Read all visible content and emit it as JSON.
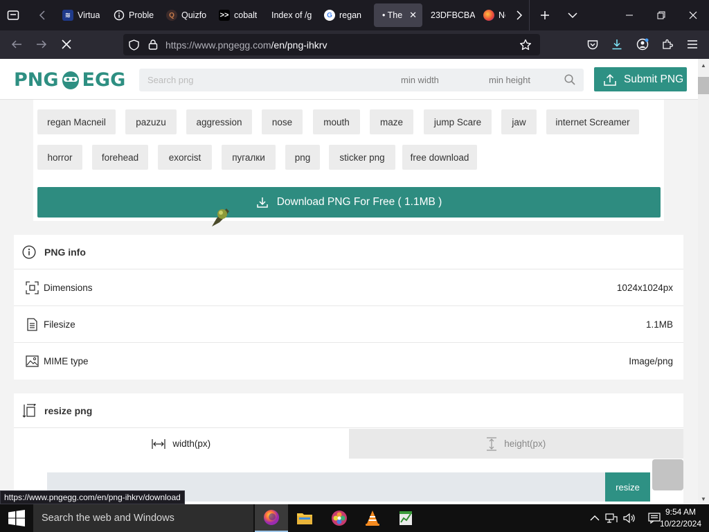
{
  "tabs": [
    {
      "title": "Virtua",
      "icon": "virtualbox-icon"
    },
    {
      "title": "Proble",
      "icon": "info-icon"
    },
    {
      "title": "Quizfo",
      "icon": "quizfor-icon"
    },
    {
      "title": "cobalt",
      "icon": "cobalt-icon"
    },
    {
      "title": "Index of /g",
      "icon": "blank-icon"
    },
    {
      "title": "regan",
      "icon": "google-icon"
    },
    {
      "title": "• The",
      "icon": "loading-icon",
      "active": true
    },
    {
      "title": "23DFBCBA",
      "icon": "blank-icon"
    },
    {
      "title": "Ne",
      "icon": "firefox-icon"
    }
  ],
  "navbar": {
    "url_host": "https://www.pngegg.com",
    "url_path": "/en/png-ihkrv"
  },
  "site": {
    "logo_left": "PNG",
    "logo_right": "EGG",
    "search_placeholder": "Search png",
    "min_width": "min width",
    "min_height": "min height",
    "submit_label": "Submit PNG"
  },
  "tags": [
    "regan Macneil",
    "pazuzu",
    "aggression",
    "nose",
    "mouth",
    "maze",
    "jump Scare",
    "jaw",
    "internet Screamer",
    "horror",
    "forehead",
    "exorcist",
    "пугалки",
    "png",
    "sticker png",
    "free download"
  ],
  "download_label": "Download PNG For Free ( 1.1MB )",
  "png_info": {
    "title": "PNG info",
    "rows": [
      {
        "label": "Dimensions",
        "value": "1024x1024px",
        "icon": "dimensions-icon"
      },
      {
        "label": "Filesize",
        "value": "1.1MB",
        "icon": "file-icon"
      },
      {
        "label": "MIME type",
        "value": "Image/png",
        "icon": "image-icon"
      }
    ]
  },
  "resize": {
    "title": "resize png",
    "width_tab": "width(px)",
    "height_tab": "height(px)",
    "button": "resize"
  },
  "status_url": "https://www.pngegg.com/en/png-ihkrv/download",
  "taskbar": {
    "search_placeholder": "Search the web and Windows",
    "time": "9:54 AM",
    "date": "10/22/2024"
  },
  "colors": {
    "accent": "#2e9184",
    "browser_dark": "#1c1b22"
  }
}
